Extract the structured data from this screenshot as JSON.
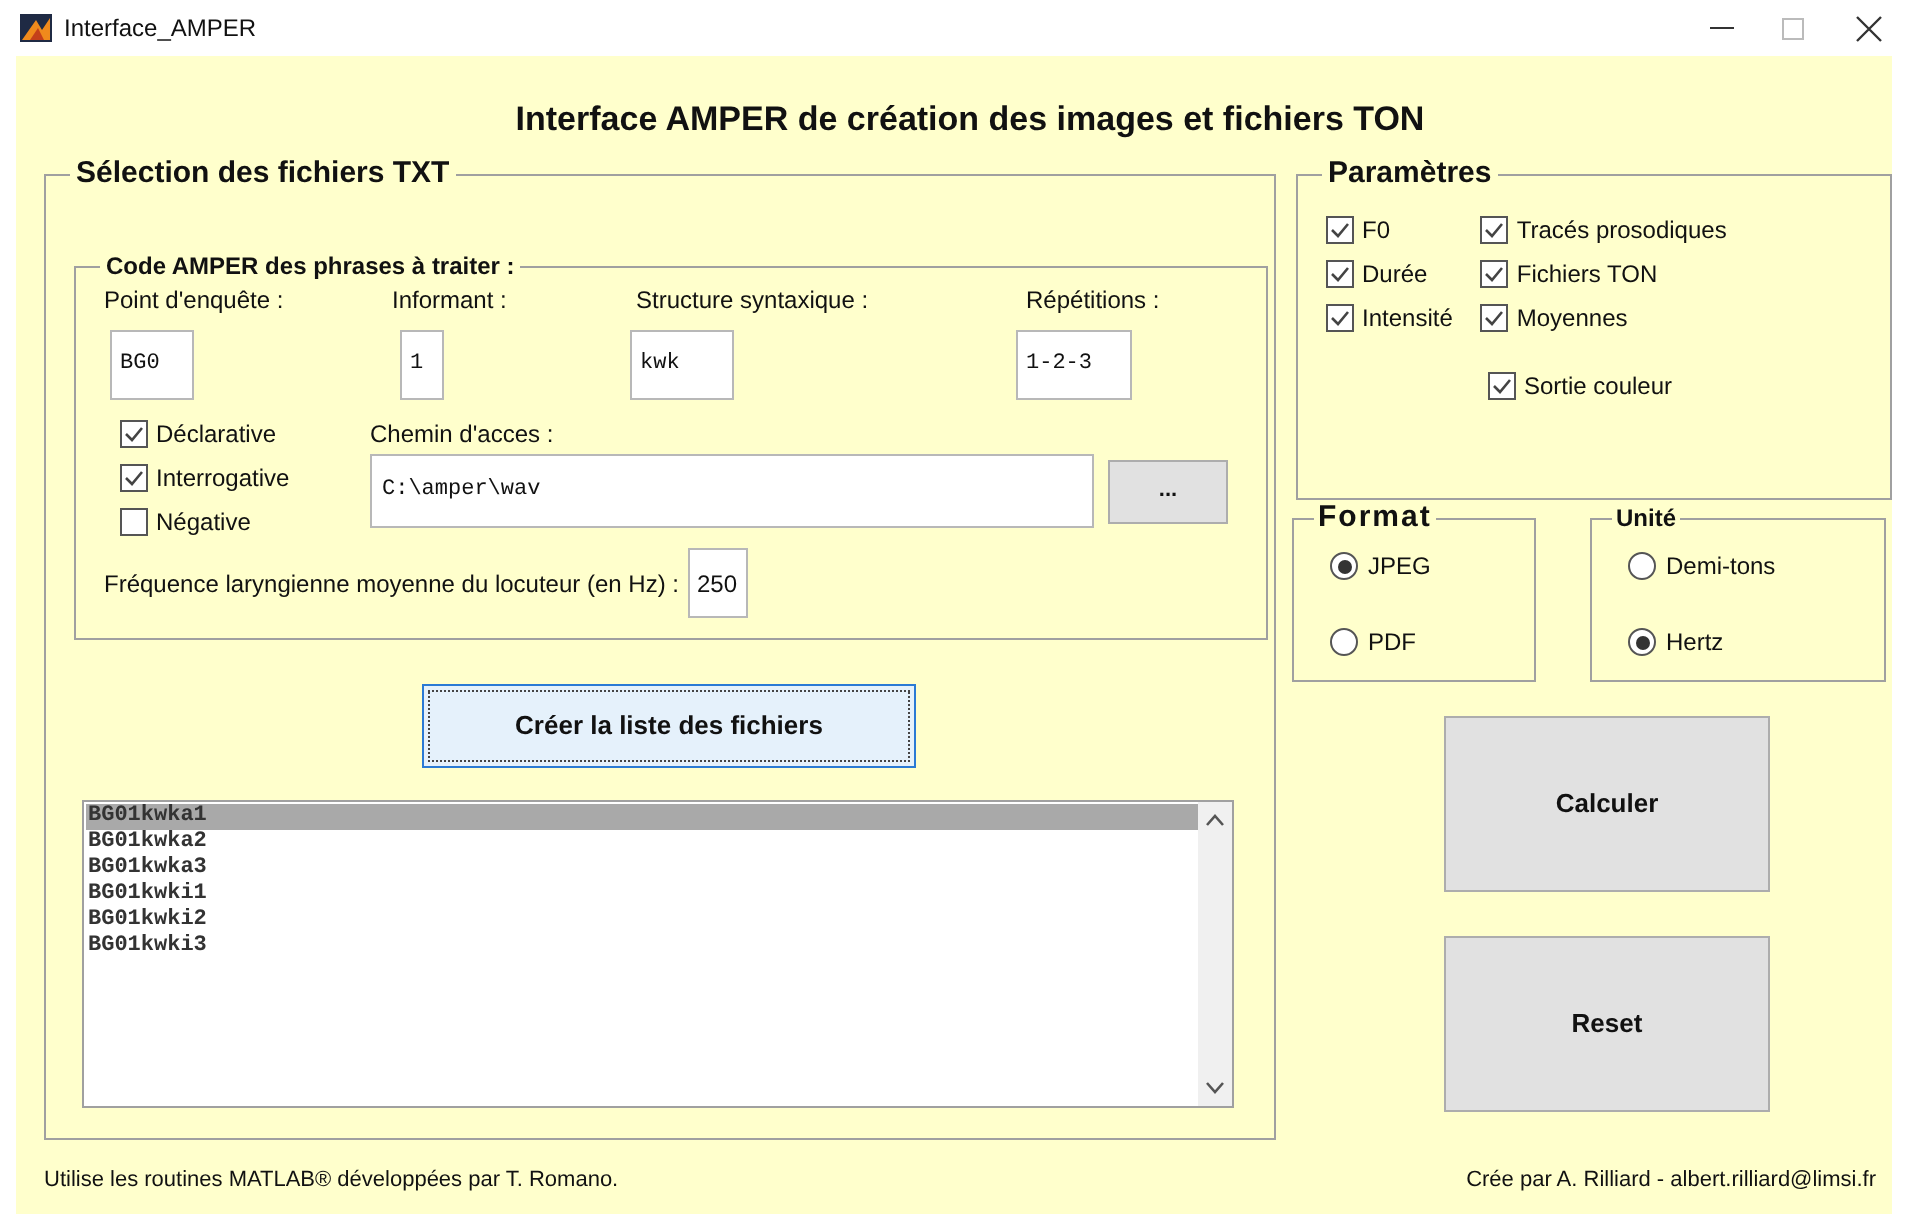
{
  "window": {
    "title": "Interface_AMPER"
  },
  "heading": "Interface AMPER de création des images et fichiers TON",
  "selection_panel": {
    "title": "Sélection des fichiers TXT",
    "code_group": {
      "title": "Code AMPER des phrases à traiter :",
      "fields": [
        {
          "label": "Point d'enquête :",
          "value": "BG0"
        },
        {
          "label": "Informant :",
          "value": "1"
        },
        {
          "label": "Structure syntaxique :",
          "value": "kwk"
        },
        {
          "label": "Répétitions :",
          "value": "1-2-3"
        }
      ],
      "sentence_types": [
        {
          "label": "Déclarative",
          "checked": true
        },
        {
          "label": "Interrogative",
          "checked": true
        },
        {
          "label": "Négative",
          "checked": false
        }
      ],
      "path_label": "Chemin d'acces :",
      "path_value": "C:\\amper\\wav",
      "browse_button": "...",
      "frequency_label": "Fréquence laryngienne moyenne du locuteur (en Hz) :",
      "frequency_value": "250"
    },
    "create_button": "Créer la liste des fichiers",
    "file_list": [
      {
        "name": "BG01kwka1",
        "selected": true
      },
      {
        "name": "BG01kwka2",
        "selected": false
      },
      {
        "name": "BG01kwka3",
        "selected": false
      },
      {
        "name": "BG01kwki1",
        "selected": false
      },
      {
        "name": "BG01kwki2",
        "selected": false
      },
      {
        "name": "BG01kwki3",
        "selected": false
      }
    ]
  },
  "parameters": {
    "title": "Paramètres",
    "options": [
      {
        "label": "F0",
        "checked": true
      },
      {
        "label": "Durée",
        "checked": true
      },
      {
        "label": "Intensité",
        "checked": true
      },
      {
        "label": "Tracés prosodiques",
        "checked": true
      },
      {
        "label": "Fichiers TON",
        "checked": true
      },
      {
        "label": "Moyennes",
        "checked": true
      },
      {
        "label": "Sortie couleur",
        "checked": true
      }
    ]
  },
  "format": {
    "title": "Format",
    "options": [
      {
        "label": "JPEG",
        "selected": true
      },
      {
        "label": "PDF",
        "selected": false
      }
    ]
  },
  "unit": {
    "title": "Unité",
    "options": [
      {
        "label": "Demi-tons",
        "selected": false
      },
      {
        "label": "Hertz",
        "selected": true
      }
    ]
  },
  "buttons": [
    "Calculer",
    "Reset"
  ],
  "footer_left": "Utilise les routines MATLAB® développées par T. Romano.",
  "footer_right": "Crée par A. Rilliard - albert.rilliard@limsi.fr"
}
